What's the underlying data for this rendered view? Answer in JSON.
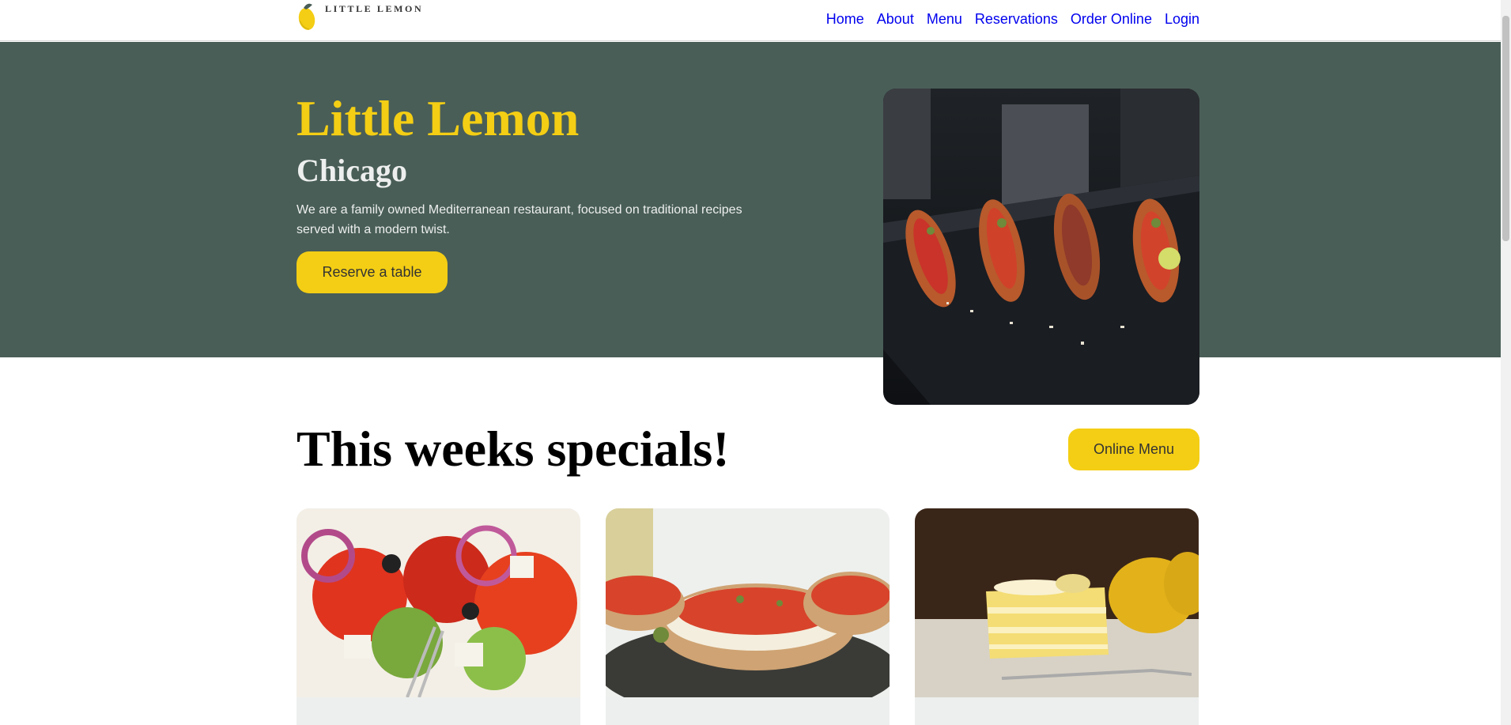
{
  "header": {
    "logo_text": "LITTLE LEMON",
    "nav": [
      {
        "label": "Home"
      },
      {
        "label": "About"
      },
      {
        "label": "Menu"
      },
      {
        "label": "Reservations"
      },
      {
        "label": "Order Online"
      },
      {
        "label": "Login"
      }
    ]
  },
  "hero": {
    "title": "Little Lemon",
    "subtitle": "Chicago",
    "description": "We are a family owned Mediterranean restaurant, focused on traditional recipes served with a modern twist.",
    "cta_label": "Reserve a table",
    "image_icon": "bruschetta-platter-image"
  },
  "specials": {
    "title": "This weeks specials!",
    "menu_button": "Online Menu",
    "cards": [
      {
        "image_icon": "greek-salad-image"
      },
      {
        "image_icon": "bruschetta-image"
      },
      {
        "image_icon": "lemon-dessert-image"
      }
    ]
  },
  "colors": {
    "primary_green": "#495e57",
    "primary_yellow": "#f4ce14",
    "highlight_light": "#edefee",
    "secondary_salmon": "#ee9972"
  }
}
